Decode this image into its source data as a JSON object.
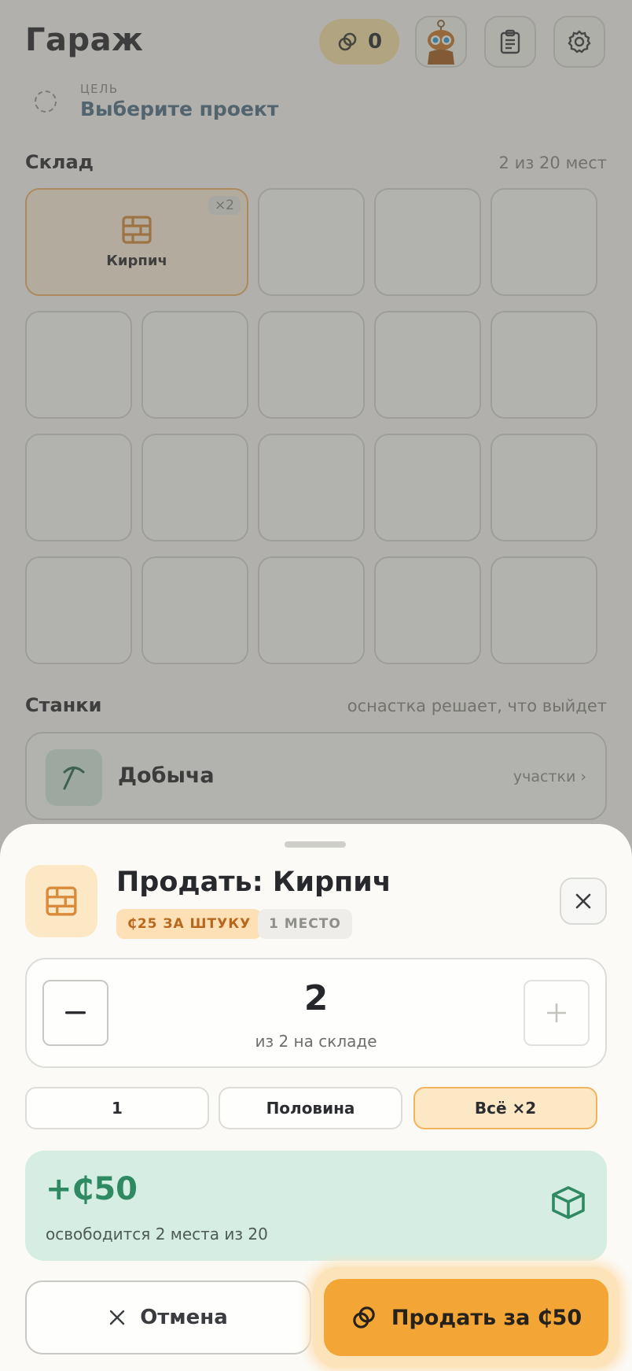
{
  "header": {
    "title": "Гараж",
    "coins": "0"
  },
  "goal": {
    "caption": "ЦЕЛЬ",
    "value": "Выберите проект"
  },
  "storage": {
    "title": "Склад",
    "capacity": "2 из 20 мест",
    "item": {
      "name": "Кирпич",
      "count": "×2"
    }
  },
  "machines": {
    "title": "Станки",
    "hint": "оснастка решает, что выйдет",
    "first": {
      "name": "Добыча",
      "link": "участки ›"
    }
  },
  "sheet": {
    "title": "Продать: Кирпич",
    "price_tag": "₵25 ЗА ШТУКУ",
    "slots_tag": "1 МЕСТО",
    "quantity": "2",
    "quantity_sub": "из 2 на складе",
    "presets": [
      "1",
      "Половина",
      "Всё ×2"
    ],
    "gain": "+₵50",
    "gain_sub": "освободится 2 места из 20",
    "cancel_label": "Отмена",
    "sell_label": "Продать за ₵50"
  },
  "colors": {
    "accent": "#f3a635",
    "success": "#2f8a63",
    "brick": "#d98a3a"
  }
}
